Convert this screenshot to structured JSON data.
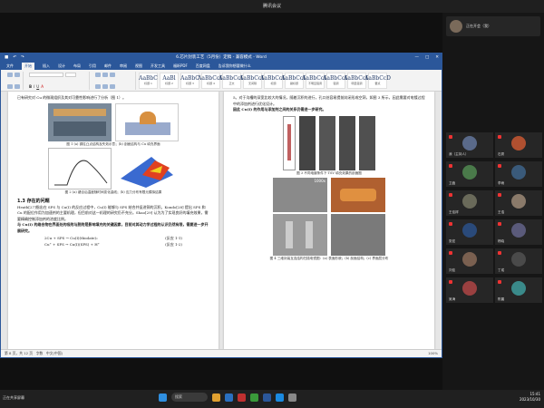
{
  "meeting": {
    "title": "腾讯会议"
  },
  "word": {
    "title": "6.芯片封装工艺（5月份）定稿 - 兼容模式 - Word",
    "menu_tabs": [
      "文件",
      "开始",
      "插入",
      "设计",
      "布局",
      "引用",
      "邮件",
      "审阅",
      "视图",
      "开发工具",
      "福昕PDF",
      "百度网盘",
      "告诉我你想要做什么"
    ],
    "active_tab": "开始",
    "styles": [
      {
        "preview": "AaBbC",
        "name": "标题 1"
      },
      {
        "preview": "AaBl",
        "name": "标题 2"
      },
      {
        "preview": "AaBbC",
        "name": "标题 3"
      },
      {
        "preview": "AaBbCcD",
        "name": "标题 4"
      },
      {
        "preview": "AaBbCcD",
        "name": "正文"
      },
      {
        "preview": "AaBbCcD",
        "name": "无间隔"
      },
      {
        "preview": "AaBbCcD",
        "name": "标题"
      },
      {
        "preview": "AaBbCcD",
        "name": "副标题"
      },
      {
        "preview": "AaBbCcD",
        "name": "不明显强调"
      },
      {
        "preview": "AaBbCcD",
        "name": "强调"
      },
      {
        "preview": "AaBbCcD",
        "name": "明显强调"
      },
      {
        "preview": "AaBbCcD",
        "name": "要点"
      }
    ],
    "left_page": {
      "intro": "已有研究对 Cu 的微观组织及其对可靠性影响进行了分析（图 1）。",
      "caption1": "图 1 (a) 铜柱凸点结构及失效示意；(b) 剖面结构与 Cu 填充界面",
      "caption2": "图 2 (a) 键合后温度随时间变化曲线；(b) 应力分布有限元模拟结果",
      "section": "1.3 存在的问题",
      "para1": "Heath[27]指出在 SPS 与 Cu(I) 的反应过程中，Cu(I) 能够与 SPS 结合并促进铜的沉积。Kondo[28] 提出 SPS 和 Cu 的配位作用为加速剂的主要机理，但目前对这一机理的研究仍不充分。Shao[29] 认为为了实现良好的填充效果，需要精确控制添加剂的浓度比例。",
      "para2": "与 Cu(I) 的络合物在界面处的吸附与脱附是影响填充的关键因素，目前对其动力学过程的认识仍然有限，需要进一步开展研究。",
      "eq1_lhs": "2Cu + SPS → Cu(I)(thiolate)₂",
      "eq1_tag": "(反应 1-1)",
      "eq2_lhs": "Cu⁺ + SPS → Cu(I)(SPS) + H⁺",
      "eq2_tag": "(反应 1-2)"
    },
    "right_page": {
      "intro": "5。对于沟槽的深宽比较大的情况，随着沉积的进行，孔口处容易提前封闭形成空洞，如图 3 所示，因此需要对电镀过程中的添加剂进行优化设计。",
      "highlight": "因此 Cu(I) 的作用与添加剂之间的关系仍需进一步研究。",
      "caption3": "图 3 不同电镀条件下 TSV 填充效果的剖面图",
      "sem_scale": "1000x",
      "caption4": "图 4 三维封装互连结构扫描电镜图：(a) 表面形貌；(b) 剖面结构；(c) 界面层分布"
    },
    "status": {
      "page": "第 8 页，共 12 页",
      "words": "字数",
      "lang": "中文(中国)",
      "zoom": "100%"
    }
  },
  "taskbar": {
    "left_label": "正在共享屏幕",
    "search": "搜索",
    "time": "15:41",
    "date": "2023/10/30"
  },
  "participants": {
    "self": "正在开会（我）",
    "tiles": [
      {
        "name": "我（主持人）",
        "color": "#5a6a8a"
      },
      {
        "name": "石秀",
        "color": "#b05030"
      },
      {
        "name": "卫鑫",
        "color": "#4a7a4a"
      },
      {
        "name": "李雨",
        "color": "#3a5a7a"
      },
      {
        "name": "王佳祥",
        "color": "#6a6a5a"
      },
      {
        "name": "王浩",
        "color": "#8a7a6a"
      },
      {
        "name": "张宏",
        "color": "#2a4a7a"
      },
      {
        "name": "杨晓",
        "color": "#5a5a7a"
      },
      {
        "name": "刘佳",
        "color": "#7a6050"
      },
      {
        "name": "丁成",
        "color": "#4a4a4a"
      },
      {
        "name": "吴海",
        "color": "#9a4040"
      },
      {
        "name": "陈晨",
        "color": "#3a8a8a"
      }
    ]
  }
}
